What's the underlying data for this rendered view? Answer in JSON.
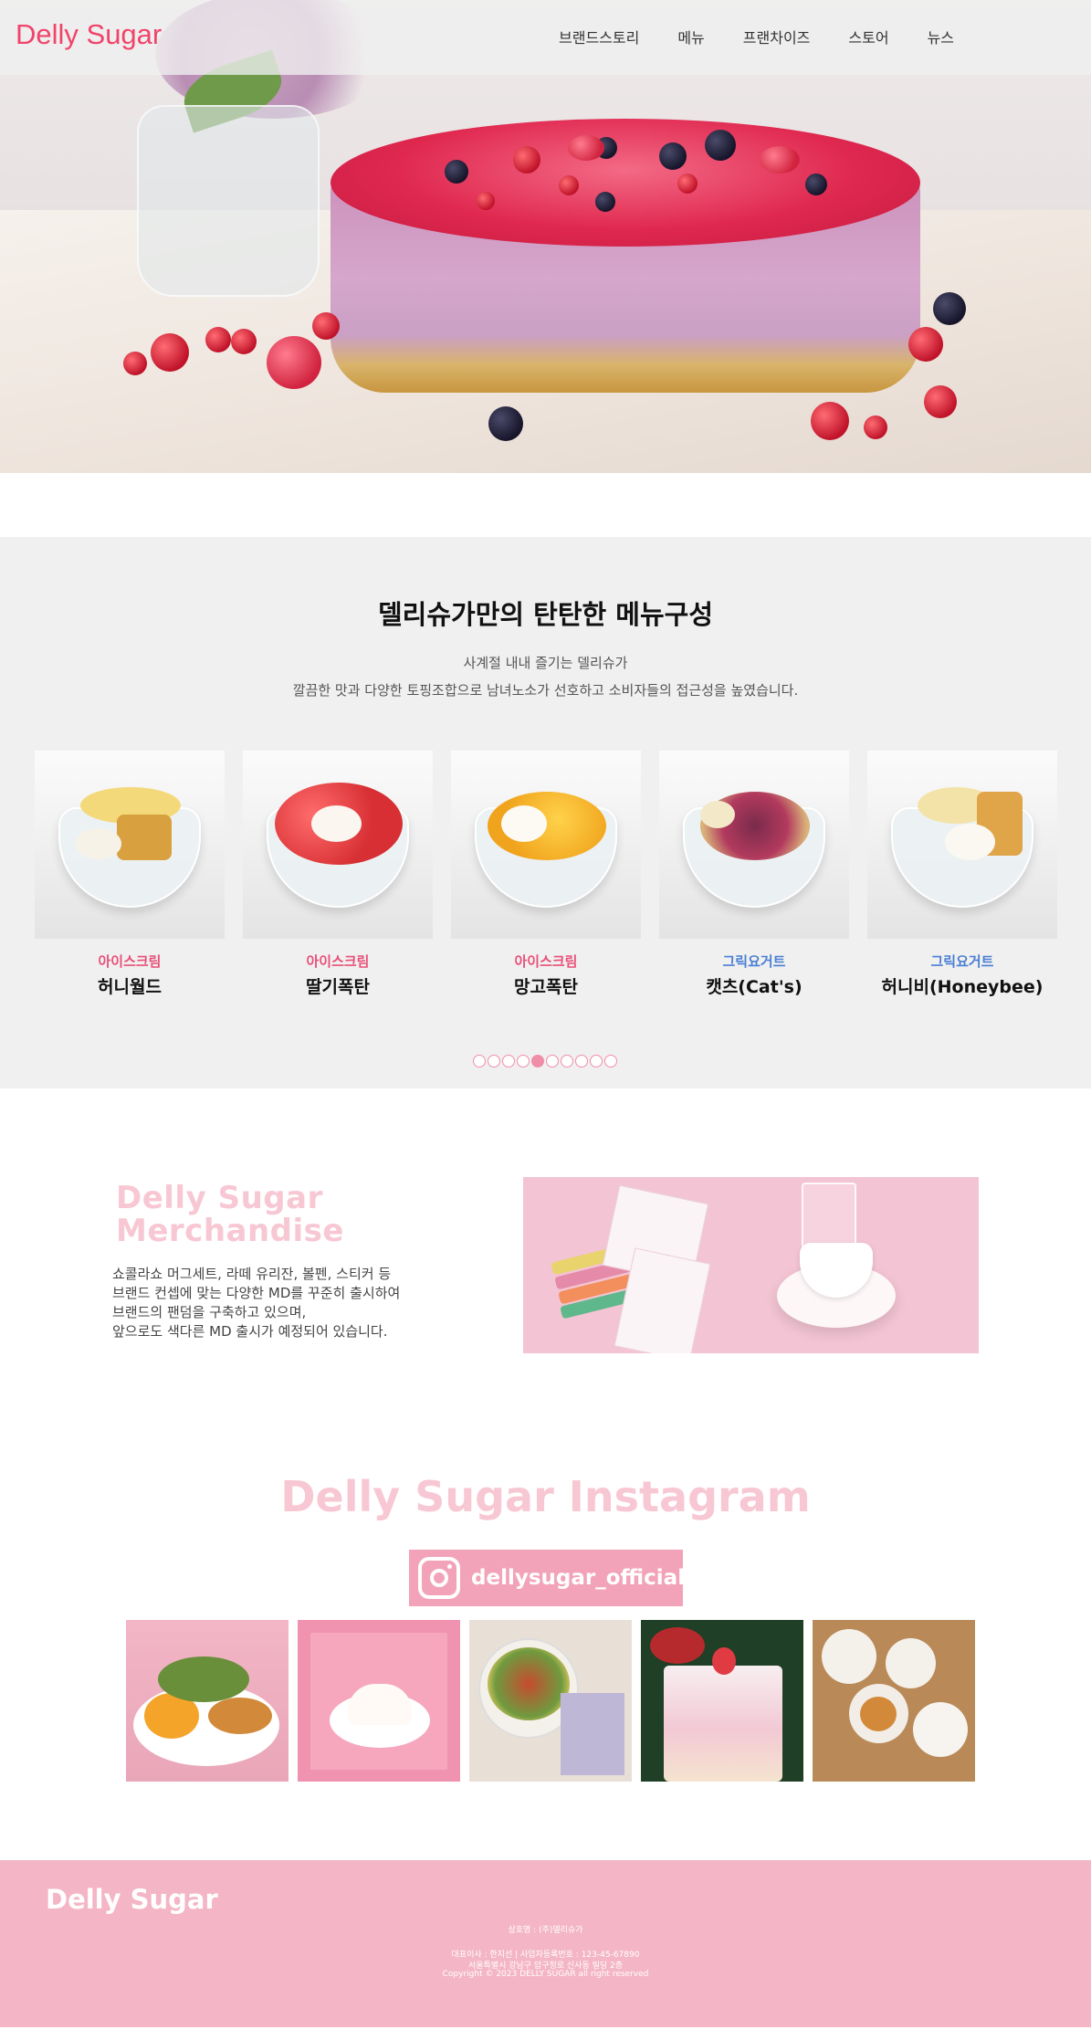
{
  "header": {
    "logo": "Delly Sugar",
    "nav": [
      "브랜드스토리",
      "메뉴",
      "프랜차이즈",
      "스토어",
      "뉴스"
    ]
  },
  "menu_section": {
    "title": "델리슈가만의 탄탄한 메뉴구성",
    "subtitle_1": "사계절 내내 즐기는 델리슈가",
    "subtitle_2": "깔끔한 맛과 다양한 토핑조합으로 남녀노소가 선호하고 소비자들의 접근성을 높였습니다.",
    "items": [
      {
        "category": "아이스크림",
        "name": "허니월드",
        "category_color": "#e8507a"
      },
      {
        "category": "아이스크림",
        "name": "딸기폭탄",
        "category_color": "#e8507a"
      },
      {
        "category": "아이스크림",
        "name": "망고폭탄",
        "category_color": "#e8507a"
      },
      {
        "category": "그릭요거트",
        "name": "캣츠(Cat's)",
        "category_color": "#4a7fd4"
      },
      {
        "category": "그릭요거트",
        "name": "허니비(Honeybee)",
        "category_color": "#4a7fd4"
      }
    ],
    "pagination": {
      "total": 10,
      "active": 5
    }
  },
  "merch": {
    "title_line_1": "Delly Sugar",
    "title_line_2": "Merchandise",
    "text_1": "쇼콜라쇼 머그세트, 라떼 유리잔, 볼펜, 스티커 등",
    "text_2": "브랜드 컨셉에 맞는 다양한 MD를 꾸준히 출시하여",
    "text_3": "브랜드의 팬덤을 구축하고 있으며,",
    "text_4": "앞으로도 색다른 MD 출시가 예정되어 있습니다."
  },
  "instagram": {
    "title": "Delly Sugar Instagram",
    "handle": "dellysugar_official",
    "post_count": 5
  },
  "footer": {
    "logo": "Delly Sugar",
    "company": "상호명 : (주)델리슈가",
    "line_1": "대표이사 : 한지선 | 사업자등록번호 : 123-45-67890",
    "line_2": "서울특별시 강남구 압구정로 신사동 빌딩 2층",
    "copyright": "Copyright © 2023 DELLY SUGAR all right reserved"
  },
  "colors": {
    "brand_pink": "#f0446a",
    "soft_pink": "#f8c7d4",
    "footer_pink": "#f4b6c6",
    "yogurt_blue": "#4a7fd4"
  }
}
